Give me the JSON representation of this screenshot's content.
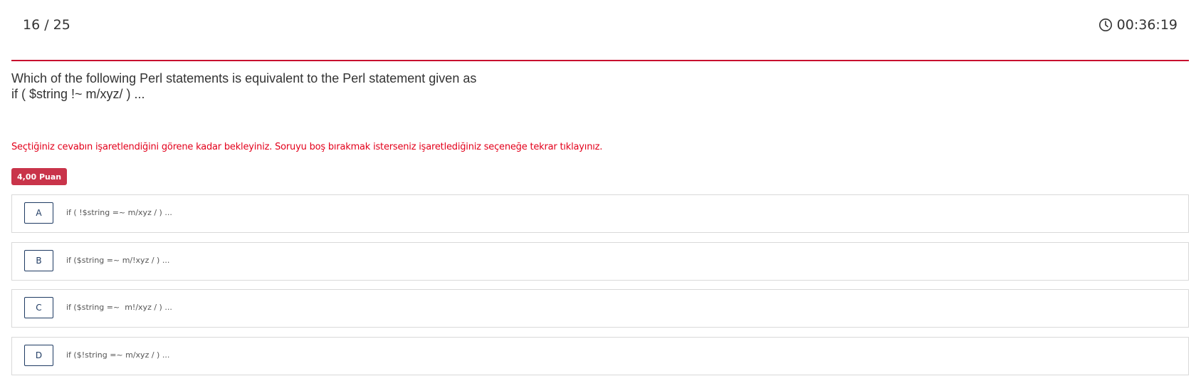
{
  "header": {
    "counter": "16 / 25",
    "timer": "00:36:19",
    "timer_icon": "clock-icon",
    "accent_color": "#c8102e"
  },
  "question": {
    "line1": "Which of the following Perl statements is equivalent to the Perl statement given as",
    "line2": "if ( $string !~ m/xyz/ ) ..."
  },
  "warning": "Seçtiğiniz cevabın işaretlendiğini görene kadar bekleyiniz. Soruyu boş bırakmak isterseniz işaretlediğiniz seçeneğe tekrar tıklayınız.",
  "points_badge": "4,00 Puan",
  "options": [
    {
      "letter": "A",
      "text": "if ( !$string =~ m/xyz / ) ..."
    },
    {
      "letter": "B",
      "text": "if ($string =~ m/!xyz / ) ..."
    },
    {
      "letter": "C",
      "text": "if ($string =~  m!/xyz / ) ..."
    },
    {
      "letter": "D",
      "text": "if ($!string =~ m/xyz / ) ..."
    }
  ]
}
